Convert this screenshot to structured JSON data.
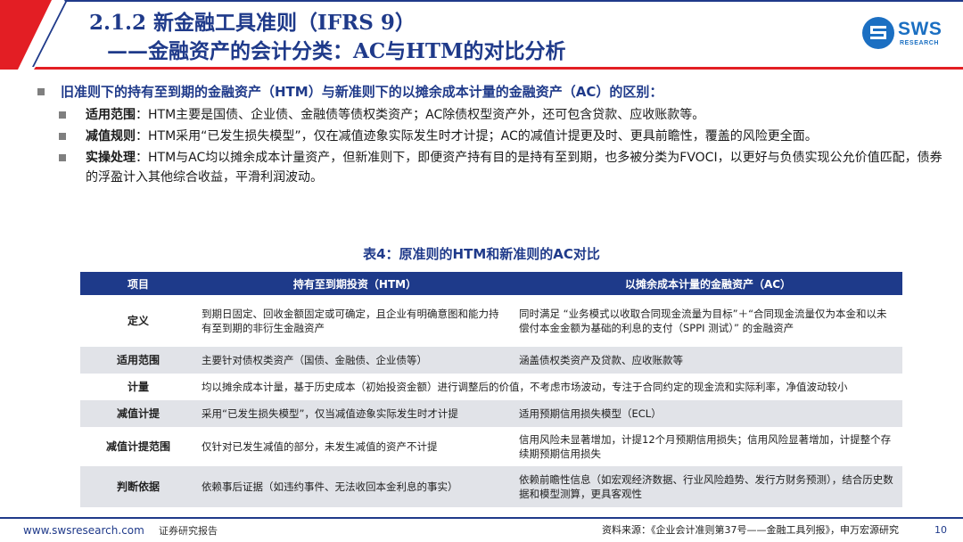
{
  "header": {
    "title_line1": "2.1.2 新金融工具准则（IFRS 9）",
    "title_line2": "——金融资产的会计分类：AC与HTM的对比分析",
    "logo_text": "SWS",
    "logo_subtext": "RESEARCH",
    "accent_color": "#e31e24",
    "brand_color": "#1f3a8a"
  },
  "intro": {
    "main_bullet": "旧准则下的持有至到期的金融资产（HTM）与新准则下的以摊余成本计量的金融资产（AC）的区别：",
    "points": [
      {
        "label": "适用范围",
        "text": "：HTM主要是国债、企业债、金融债等债权类资产；AC除债权型资产外，还可包含贷款、应收账款等。"
      },
      {
        "label": "减值规则",
        "text": "：HTM采用“已发生损失模型”，仅在减值迹象实际发生时才计提；AC的减值计提更及时、更具前瞻性，覆盖的风险更全面。"
      },
      {
        "label": "实操处理",
        "text": "：HTM与AC均以摊余成本计量资产，但新准则下，即便资产持有目的是持有至到期，也多被分类为FVOCI，以更好与负债实现公允价值匹配，债券的浮盈计入其他综合收益，平滑利润波动。"
      }
    ]
  },
  "table": {
    "title": "表4：原准则的HTM和新准则的AC对比",
    "headers": [
      "项目",
      "持有至到期投资（HTM）",
      "以摊余成本计量的金融资产（AC）"
    ],
    "rows": [
      {
        "item": "定义",
        "htm": "到期日固定、回收金额固定或可确定，且企业有明确意图和能力持有至到期的非衍生金融资产",
        "ac": "同时满足 “业务模式以收取合同现金流量为目标”＋“合同现金流量仅为本金和以未偿付本金金额为基础的利息的支付（SPPI 测试）” 的金融资产"
      },
      {
        "item": "适用范围",
        "htm": "主要针对债权类资产（国债、金融债、企业债等）",
        "ac": "涵盖债权类资产及贷款、应收账款等"
      },
      {
        "item": "计量",
        "merged": "均以摊余成本计量，基于历史成本（初始投资金额）进行调整后的价值，不考虑市场波动，专注于合同约定的现金流和实际利率，净值波动较小"
      },
      {
        "item": "减值计提",
        "htm": "采用“已发生损失模型”，仅当减值迹象实际发生时才计提",
        "ac": "适用预期信用损失模型（ECL）"
      },
      {
        "item": "减值计提范围",
        "htm": "仅针对已发生减值的部分，未发生减值的资产不计提",
        "ac": "信用风险未显著增加，计提12个月预期信用损失；信用风险显著增加，计提整个存续期预期信用损失"
      },
      {
        "item": "判断依据",
        "htm": "依赖事后证据（如违约事件、无法收回本金利息的事实）",
        "ac": "依赖前瞻性信息（如宏观经济数据、行业风险趋势、发行方财务预测），结合历史数据和模型测算，更具客观性"
      }
    ]
  },
  "footer": {
    "url": "www.swsresearch.com",
    "report_type": "证券研究报告",
    "source": "资料来源：《企业会计准则第37号——金融工具列报》，申万宏源研究",
    "page_number": "10"
  }
}
